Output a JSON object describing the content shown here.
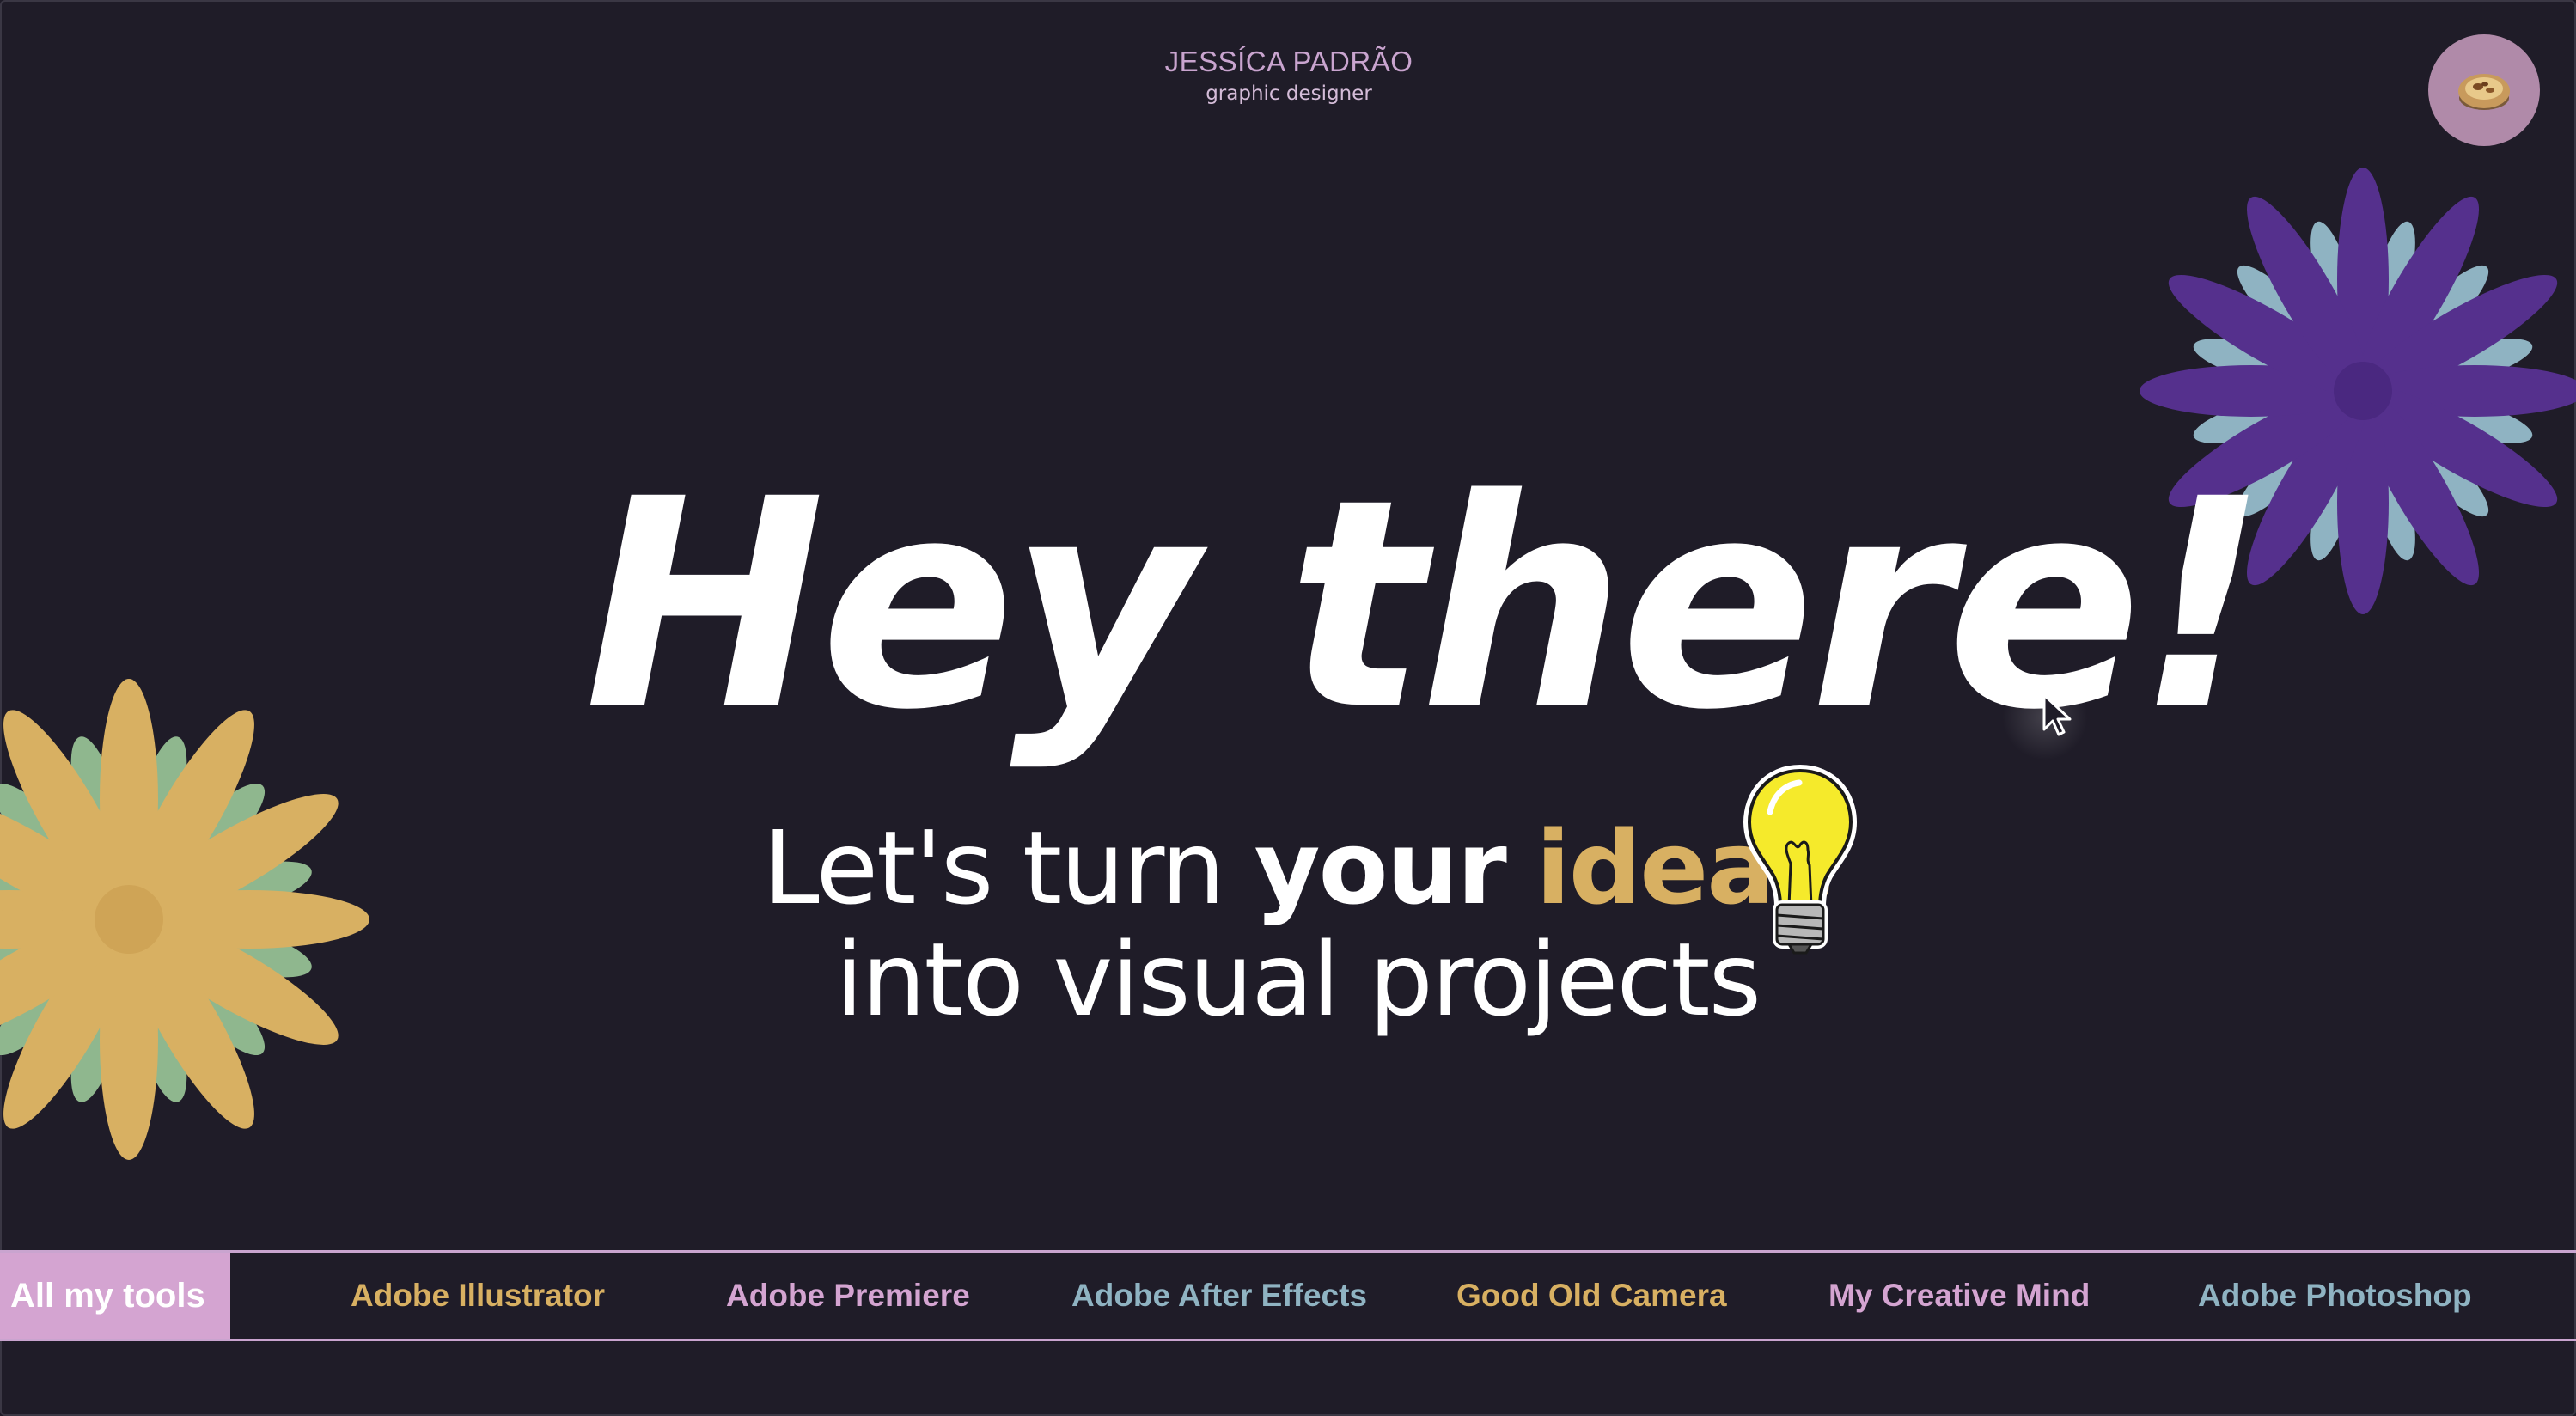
{
  "header": {
    "name": "JESSÍCA PADRÃO",
    "role": "graphic designer"
  },
  "avatar": {
    "icon": "pastry-icon"
  },
  "hero": {
    "title": "Hey there!",
    "subtitle_part1": "Let's turn ",
    "subtitle_part2": "your",
    "subtitle_part3": " ",
    "subtitle_highlight": "ideas",
    "subtitle_line2": "into visual projects",
    "icon": "lightbulb-icon"
  },
  "tools_bar": {
    "label": "All my tools",
    "items": [
      {
        "label": "Adobe Illustrator",
        "color": "#d8b062"
      },
      {
        "label": "Adobe Premiere",
        "color": "#d4a4d1"
      },
      {
        "label": "Adobe After Effects",
        "color": "#8fb3c2"
      },
      {
        "label": "Good Old Camera",
        "color": "#d8b062"
      },
      {
        "label": "My Creative Mind",
        "color": "#d4a4d1"
      },
      {
        "label": "Adobe Photoshop",
        "color": "#8fb3c2"
      }
    ]
  },
  "colors": {
    "background": "#1f1c28",
    "accent_gold": "#d8b062",
    "accent_pink": "#d4a4d1",
    "accent_blue": "#8fb3c2",
    "flower_purple": "#55308d",
    "flower_green": "#8fb78e"
  }
}
